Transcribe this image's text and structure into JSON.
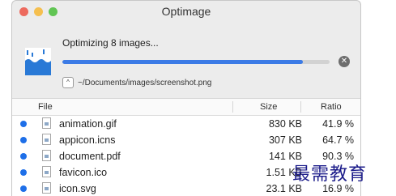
{
  "window": {
    "title": "Optimage"
  },
  "progress": {
    "status": "Optimizing 8 images...",
    "fraction": 0.9,
    "path": "~/Documents/images/screenshot.png",
    "stop_glyph": "✕",
    "disclosure_glyph": "^"
  },
  "table": {
    "headers": {
      "file": "File",
      "size": "Size",
      "ratio": "Ratio"
    },
    "rows": [
      {
        "name": "animation.gif",
        "size": "830 KB",
        "ratio": "41.9 %"
      },
      {
        "name": "appicon.icns",
        "size": "307 KB",
        "ratio": "64.7 %"
      },
      {
        "name": "document.pdf",
        "size": "141 KB",
        "ratio": "90.3 %"
      },
      {
        "name": "favicon.ico",
        "size": "1.51 KB",
        "ratio": ""
      },
      {
        "name": "icon.svg",
        "size": "23.1 KB",
        "ratio": "16.9 %"
      }
    ]
  },
  "watermark": "最需教育",
  "colors": {
    "accent": "#3c7be6",
    "status_dot": "#1e6fe8",
    "close": "#ed6a5e",
    "minimize": "#f5bf4f",
    "maximize": "#61c554"
  }
}
